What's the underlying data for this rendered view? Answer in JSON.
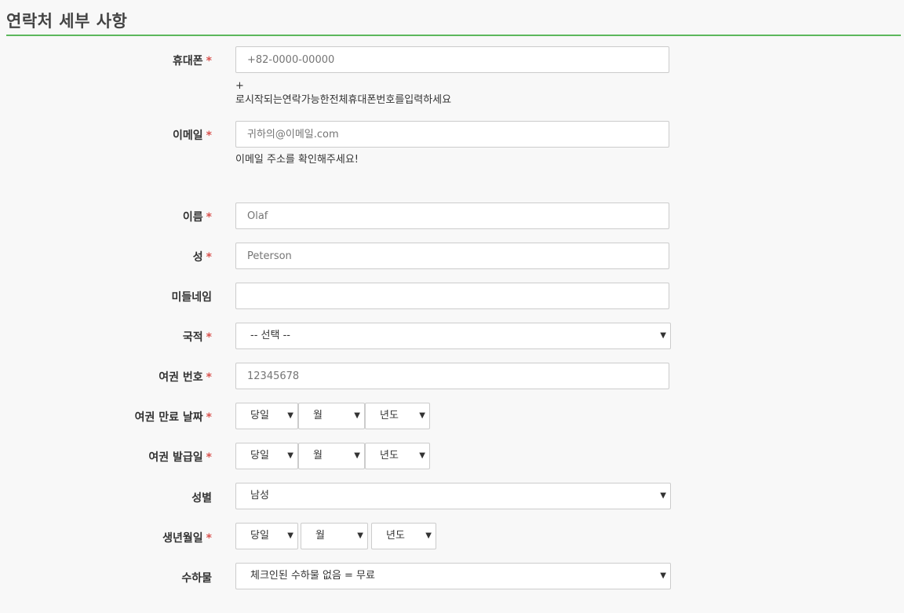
{
  "section": {
    "title": "연락처 세부 사항"
  },
  "required_mark": "*",
  "fields": {
    "mobile": {
      "label": "휴대폰",
      "placeholder": "+82-0000-00000",
      "help_line1": "+",
      "help_line2": "로시작되는연락가능한전체휴대폰번호를입력하세요"
    },
    "email": {
      "label": "이메일",
      "placeholder": "귀하의@이메일.com",
      "help": "이메일 주소를 확인해주세요!"
    },
    "first_name": {
      "label": "이름",
      "placeholder": "Olaf"
    },
    "last_name": {
      "label": "성",
      "placeholder": "Peterson"
    },
    "middle_name": {
      "label": "미들네임",
      "placeholder": ""
    },
    "nationality": {
      "label": "국적",
      "value": "-- 선택 --"
    },
    "passport_number": {
      "label": "여권 번호",
      "placeholder": "12345678"
    },
    "passport_expiry": {
      "label": "여권 만료 날짜",
      "day": "당일",
      "month": "월",
      "year": "년도"
    },
    "passport_issue": {
      "label": "여권 발급일",
      "day": "당일",
      "month": "월",
      "year": "년도"
    },
    "gender": {
      "label": "성별",
      "value": "남성"
    },
    "birth_date": {
      "label": "생년월일",
      "day": "당일",
      "month": "월",
      "year": "년도"
    },
    "baggage": {
      "label": "수하물",
      "value": "체크인된 수하물 없음 = 무료"
    }
  }
}
